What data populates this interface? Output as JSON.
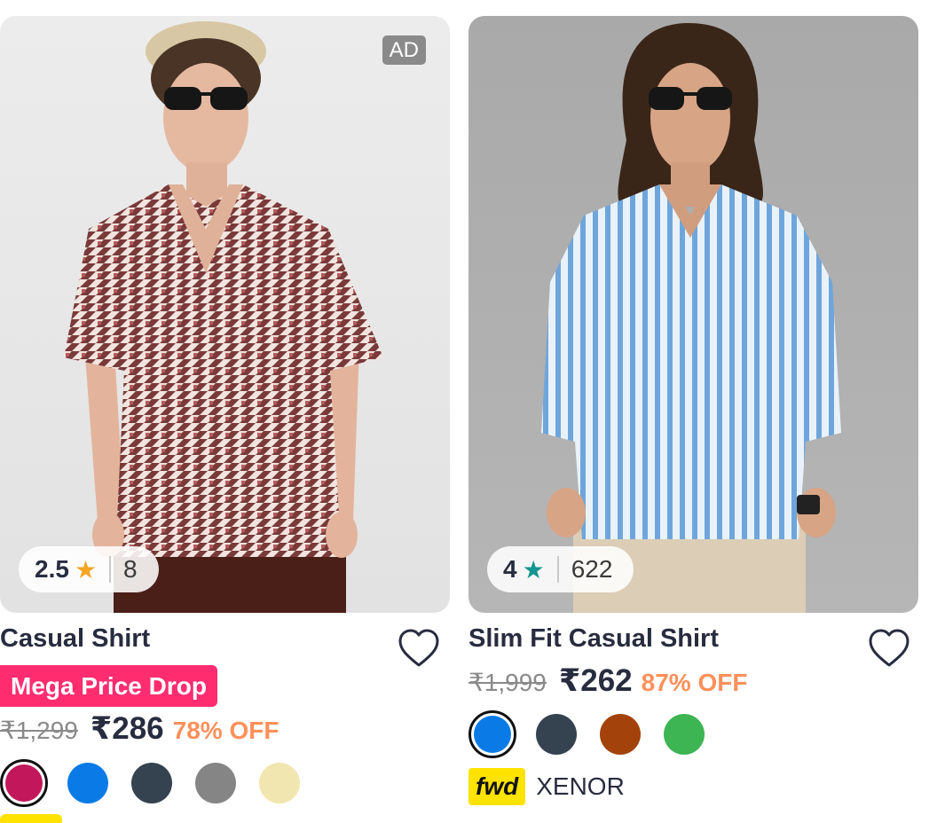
{
  "products": [
    {
      "ad_label": "AD",
      "rating": "2.5",
      "rating_count": "8",
      "star_color": "#f5a623",
      "title": "Casual Shirt",
      "badge": "Mega Price Drop",
      "mrp": "₹1,299",
      "price": "₹286",
      "discount": "78% OFF",
      "wishlist_icon": "heart-outline-icon",
      "swatch_colors": [
        "#c2185b",
        "#0a7ae6",
        "#35424f",
        "#858585",
        "#f2e6b0"
      ]
    },
    {
      "rating": "4",
      "rating_count": "622",
      "star_color": "#14958f",
      "title": "Slim Fit Casual Shirt",
      "mrp": "₹1,999",
      "price": "₹262",
      "discount": "87% OFF",
      "wishlist_icon": "heart-outline-icon",
      "swatch_colors": [
        "#0a7ae6",
        "#35424f",
        "#a3420b",
        "#3db553"
      ],
      "fwd_logo": "fwd",
      "brand": "XENOR"
    }
  ]
}
